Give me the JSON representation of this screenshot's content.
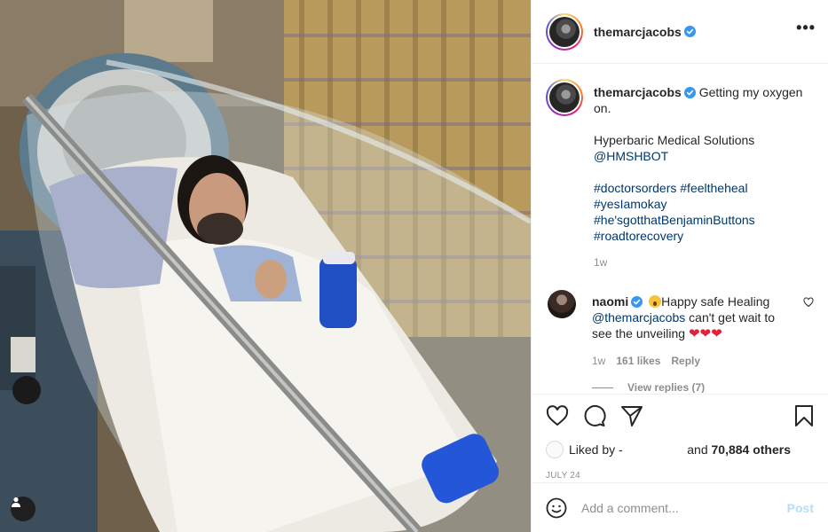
{
  "post": {
    "username": "themarcjacobs",
    "verified": true,
    "caption": {
      "line1": "Getting my oxygen on.",
      "line2": "Hyperbaric Medical Solutions",
      "mention": "@HMSHBOT",
      "hashtags": [
        "#doctorsorders #feeltheheal",
        "#yesIamokay",
        "#he'sgotthatBenjaminButtons",
        "#roadtorecovery"
      ]
    },
    "caption_age": "1w"
  },
  "comments": [
    {
      "username": "naomi",
      "verified": true,
      "text_start": "Happy safe Healing",
      "mention": "@themarcjacobs",
      "text_end": " can't get wait to see the unveiling ",
      "hearts": "❤❤❤",
      "age": "1w",
      "likes": "161 likes",
      "reply": "Reply",
      "view_replies": "View replies (7)"
    }
  ],
  "likes": {
    "liked_by": "Liked by",
    "liked_by_user": "-",
    "and_text": "and",
    "others": "70,884 others"
  },
  "date": "JULY 24",
  "add_comment": {
    "placeholder": "Add a comment...",
    "post_label": "Post"
  },
  "icons": {
    "like": "heart-icon",
    "comment": "comment-icon",
    "share": "share-icon",
    "save": "bookmark-icon",
    "more": "more-options-icon",
    "emoji": "emoji-icon",
    "tagged": "tagged-user-icon"
  },
  "colors": {
    "verified_blue": "#3897f0",
    "link_blue": "#00376b",
    "heart_red": "#e0223a",
    "post_button": "#b2dffc"
  }
}
